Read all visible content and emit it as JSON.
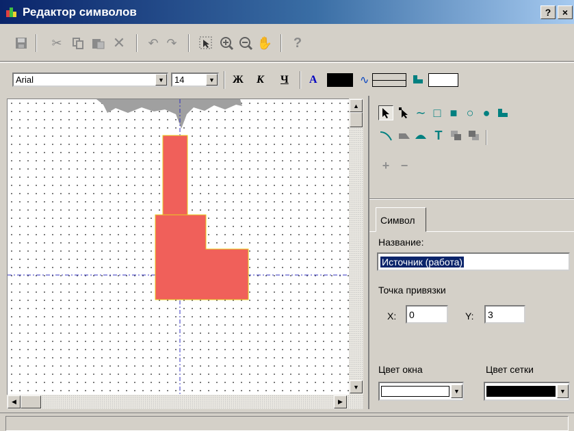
{
  "window": {
    "title": "Редактор символов",
    "help_button": "?",
    "close_button": "×"
  },
  "toolbar": {
    "icons": [
      "save-icon",
      "cut-icon",
      "copy-icon",
      "paste-icon",
      "delete-icon",
      "undo-icon",
      "redo-icon",
      "select-area-icon",
      "zoom-in-icon",
      "zoom-out-icon",
      "pan-hand-icon",
      "help-icon"
    ]
  },
  "format_bar": {
    "font_family": "Arial",
    "font_size": "14",
    "bold_label": "Ж",
    "italic_label": "К",
    "underline_label": "Ч",
    "text_color_label": "A",
    "text_color": "#000000",
    "line_style": "solid",
    "fill_color": "#ffffff"
  },
  "canvas": {
    "background": "#ffffff",
    "shape_fill": "#f0605a",
    "shape_outline": "#e8d020",
    "cloud_color": "#a0a0a0",
    "axis_color": "#3030c0"
  },
  "tools": {
    "row1": [
      "select-arrow-icon",
      "node-select-icon",
      "polyline-icon",
      "rectangle-icon",
      "filled-rectangle-icon",
      "ellipse-icon",
      "filled-ellipse-icon",
      "polygon-icon"
    ],
    "row2": [
      "arc-icon",
      "filled-polygon-icon",
      "filled-arc-icon",
      "text-tool-icon",
      "bring-forward-icon",
      "send-backward-icon"
    ],
    "row3": [
      "add-node-icon",
      "remove-node-icon"
    ]
  },
  "properties": {
    "tab_label": "Символ",
    "name_label": "Название:",
    "name_value": "Источник (работа)",
    "anchor_label": "Точка привязки",
    "x_label": "X:",
    "x_value": "0",
    "y_label": "Y:",
    "y_value": "3",
    "window_color_label": "Цвет окна",
    "window_color": "#ffffff",
    "grid_color_label": "Цвет сетки",
    "grid_color": "#000000"
  }
}
